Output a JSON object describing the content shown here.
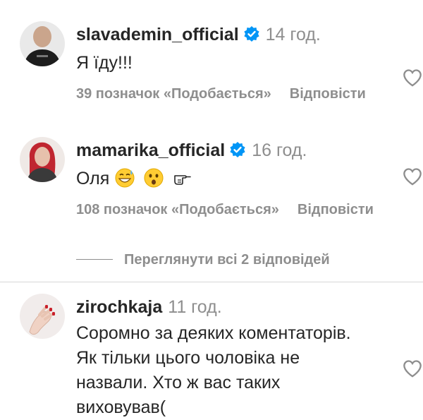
{
  "comments": [
    {
      "username": "slavademin_official",
      "verified": true,
      "time": "14 год.",
      "text": "Я їду!!!",
      "likes": "39 позначок «Подобається»",
      "reply": "Відповісти"
    },
    {
      "username": "mamarika_official",
      "verified": true,
      "time": "16 год.",
      "text": "Оля",
      "emoji": [
        "grinning-sweat-emoji",
        "astonished-face-emoji",
        "pointing-hand-emoji"
      ],
      "likes": "108 позначок «Подобається»",
      "reply": "Відповісти"
    },
    {
      "username": "zirochkaja",
      "verified": false,
      "time": "11 год.",
      "text_lines": [
        "Соромно за деяких коментаторів.",
        "Як тільки цього чоловіка не",
        "назвали. Хто ж вас таких",
        "виховував("
      ]
    }
  ],
  "view_replies": "Переглянути всі 2 відповідей",
  "colors": {
    "text": "#262626",
    "secondary": "#8e8e8e",
    "verified": "#0095f6"
  }
}
